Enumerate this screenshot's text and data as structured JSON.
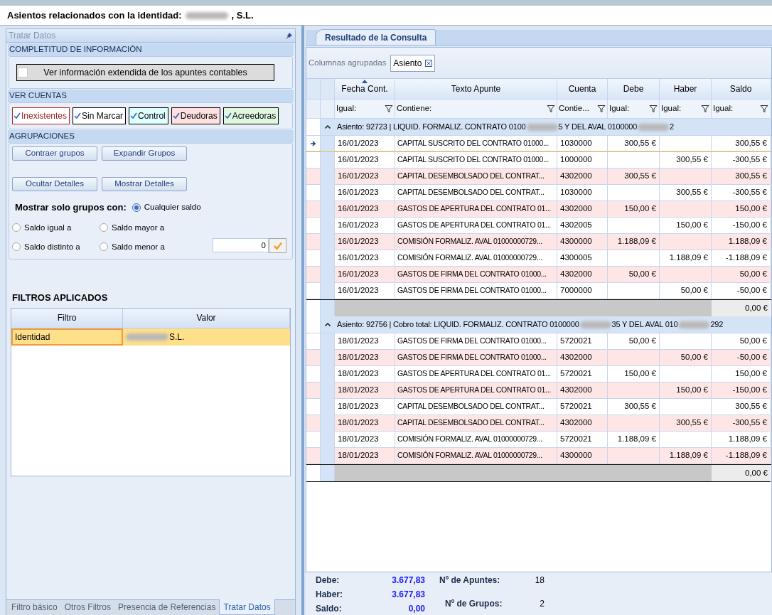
{
  "title": {
    "parts": [
      "Asientos relacionados con la identidad:",
      ", S.L."
    ]
  },
  "left_panel": {
    "title": "Tratar Datos",
    "sections": [
      {
        "kind": "completeness",
        "header": "COMPLETITUD DE INFORMACIÓN",
        "toggle": {
          "label": "Ver información extendida de los apuntes contables",
          "checked": false
        }
      },
      {
        "kind": "accounts",
        "header": "VER CUENTAS",
        "checkboxes": [
          {
            "label": "Inexistentes",
            "checked": true,
            "kind": "missing",
            "color": "#ffffff"
          },
          {
            "label": "Sin Marcar",
            "checked": true,
            "kind": "normal",
            "color": "#ffffff"
          },
          {
            "label": "Control",
            "checked": true,
            "kind": "normal",
            "color": "#e0ffff"
          },
          {
            "label": "Deudoras",
            "checked": true,
            "kind": "normal",
            "color": "#ffe0e0"
          },
          {
            "label": "Acreedoras",
            "checked": true,
            "kind": "normal",
            "color": "#e0f8e0"
          }
        ]
      },
      {
        "kind": "grouping",
        "header": "AGRUPACIONES",
        "buttons": [
          [
            "Contraer grupos",
            "Expandir Grupos"
          ],
          [
            "Ocultar Detalles",
            "Mostrar Detalles"
          ]
        ],
        "show_label": "Mostrar solo grupos con:",
        "options": [
          {
            "label": "Cualquier saldo",
            "selected": true
          },
          {
            "label": "Saldo igual a",
            "selected": false
          },
          {
            "label": "Saldo mayor a",
            "selected": false
          },
          {
            "label": "Saldo distinto a",
            "selected": false
          },
          {
            "label": "Saldo menor a",
            "selected": false
          }
        ],
        "amount": "0"
      }
    ],
    "filters": {
      "title": "FILTROS APLICADOS",
      "columns": [
        "Filtro",
        "Valor"
      ],
      "rows": [
        {
          "filter": "Identidad",
          "value": {
            "parts": [
              "S.L."
            ],
            "lead_blur": true
          },
          "selected": true
        }
      ]
    },
    "bottom_tabs": [
      {
        "label": "Filtro básico",
        "selected": false
      },
      {
        "label": "Otros Filtros",
        "selected": false
      },
      {
        "label": "Presencia de Referencias",
        "selected": false
      },
      {
        "label": "Tratar Datos",
        "selected": true
      }
    ]
  },
  "result": {
    "tab": "Resultado de la Consulta",
    "grouped_label": "Columnas agrupadas",
    "grouped_chip": "Asiento",
    "columns": [
      "Fecha Cont.",
      "Texto Apunte",
      "Cuenta",
      "Debe",
      "Haber",
      "Saldo"
    ],
    "filters": [
      "Igual:",
      "Contiene:",
      "Contie...",
      "Igual:",
      "Igual:",
      "Igual:"
    ],
    "groups": [
      {
        "label": {
          "parts": [
            "Asiento: 92723 | LIQUID. FORMALIZ. CONTRATO 0100",
            "5 Y DEL AVAL 0100000",
            "2"
          ]
        },
        "expanded": true,
        "total": "0,00 €",
        "rows": [
          {
            "date": "16/01/2023",
            "text": "CAPITAL SUSCRITO DEL CONTRATO 01000...",
            "account": "1030000",
            "debe": "300,55 €",
            "haber": "",
            "saldo": "300,55 €",
            "highlighted": false,
            "selected": true
          },
          {
            "date": "16/01/2023",
            "text": "CAPITAL SUSCRITO DEL CONTRATO 01000...",
            "account": "1000000",
            "debe": "",
            "haber": "300,55 €",
            "saldo": "-300,55 €",
            "highlighted": false,
            "selected": false
          },
          {
            "date": "16/01/2023",
            "text": "CAPITAL DESEMBOLSADO DEL CONTRAT...",
            "account": "4302000",
            "debe": "300,55 €",
            "haber": "",
            "saldo": "300,55 €",
            "highlighted": true,
            "selected": false
          },
          {
            "date": "16/01/2023",
            "text": "CAPITAL DESEMBOLSADO DEL CONTRAT...",
            "account": "1030000",
            "debe": "",
            "haber": "300,55 €",
            "saldo": "-300,55 €",
            "highlighted": false,
            "selected": false
          },
          {
            "date": "16/01/2023",
            "text": "GASTOS DE APERTURA DEL CONTRATO 01...",
            "account": "4302000",
            "debe": "150,00 €",
            "haber": "",
            "saldo": "150,00 €",
            "highlighted": true,
            "selected": false
          },
          {
            "date": "16/01/2023",
            "text": "GASTOS DE APERTURA DEL CONTRATO 01...",
            "account": "4302005",
            "debe": "",
            "haber": "150,00 €",
            "saldo": "-150,00 €",
            "highlighted": false,
            "selected": false
          },
          {
            "date": "16/01/2023",
            "text": "COMISIÓN FORMALIZ. AVAL 01000000729...",
            "account": "4300000",
            "debe": "1.188,09 €",
            "haber": "",
            "saldo": "1.188,09 €",
            "highlighted": true,
            "selected": false
          },
          {
            "date": "16/01/2023",
            "text": "COMISIÓN FORMALIZ. AVAL 01000000729...",
            "account": "4300005",
            "debe": "",
            "haber": "1.188,09 €",
            "saldo": "-1.188,09 €",
            "highlighted": false,
            "selected": false
          },
          {
            "date": "16/01/2023",
            "text": "GASTOS DE FIRMA DEL CONTRATO 01000...",
            "account": "4302000",
            "debe": "50,00 €",
            "haber": "",
            "saldo": "50,00 €",
            "highlighted": true,
            "selected": false
          },
          {
            "date": "16/01/2023",
            "text": "GASTOS DE FIRMA DEL CONTRATO 01000...",
            "account": "7000000",
            "debe": "",
            "haber": "50,00 €",
            "saldo": "-50,00 €",
            "highlighted": false,
            "selected": false
          }
        ]
      },
      {
        "label": {
          "parts": [
            "Asiento: 92756 | Cobro total: LIQUID. FORMALIZ. CONTRATO 0100000",
            "35 Y DEL AVAL 010",
            "292"
          ]
        },
        "expanded": true,
        "total": "0,00 €",
        "rows": [
          {
            "date": "18/01/2023",
            "text": "GASTOS DE FIRMA DEL CONTRATO 01000...",
            "account": "5720021",
            "debe": "50,00 €",
            "haber": "",
            "saldo": "50,00 €",
            "highlighted": false,
            "selected": false
          },
          {
            "date": "18/01/2023",
            "text": "GASTOS DE FIRMA DEL CONTRATO 01000...",
            "account": "4302000",
            "debe": "",
            "haber": "50,00 €",
            "saldo": "-50,00 €",
            "highlighted": true,
            "selected": false
          },
          {
            "date": "18/01/2023",
            "text": "GASTOS DE APERTURA DEL CONTRATO 01...",
            "account": "5720021",
            "debe": "150,00 €",
            "haber": "",
            "saldo": "150,00 €",
            "highlighted": false,
            "selected": false
          },
          {
            "date": "18/01/2023",
            "text": "GASTOS DE APERTURA DEL CONTRATO 01...",
            "account": "4302000",
            "debe": "",
            "haber": "150,00 €",
            "saldo": "-150,00 €",
            "highlighted": true,
            "selected": false
          },
          {
            "date": "18/01/2023",
            "text": "CAPITAL DESEMBOLSADO DEL CONTRAT...",
            "account": "5720021",
            "debe": "300,55 €",
            "haber": "",
            "saldo": "300,55 €",
            "highlighted": false,
            "selected": false
          },
          {
            "date": "18/01/2023",
            "text": "CAPITAL DESEMBOLSADO DEL CONTRAT...",
            "account": "4302000",
            "debe": "",
            "haber": "300,55 €",
            "saldo": "-300,55 €",
            "highlighted": true,
            "selected": false
          },
          {
            "date": "18/01/2023",
            "text": "COMISIÓN FORMALIZ. AVAL 01000000729...",
            "account": "5720021",
            "debe": "1.188,09 €",
            "haber": "",
            "saldo": "1.188,09 €",
            "highlighted": false,
            "selected": false
          },
          {
            "date": "18/01/2023",
            "text": "COMISIÓN FORMALIZ. AVAL 01000000729...",
            "account": "4300000",
            "debe": "",
            "haber": "1.188,09 €",
            "saldo": "-1.188,09 €",
            "highlighted": true,
            "selected": false
          }
        ]
      }
    ],
    "summary": {
      "totals": [
        {
          "label": "Debe:",
          "value": "3.677,83"
        },
        {
          "label": "Haber:",
          "value": "3.677,83"
        },
        {
          "label": "Saldo:",
          "value": "0,00"
        }
      ],
      "counts": [
        {
          "label": "Nº de Apuntes:",
          "value": "18"
        },
        {
          "label": "Nº de Grupos:",
          "value": "2"
        }
      ]
    }
  }
}
